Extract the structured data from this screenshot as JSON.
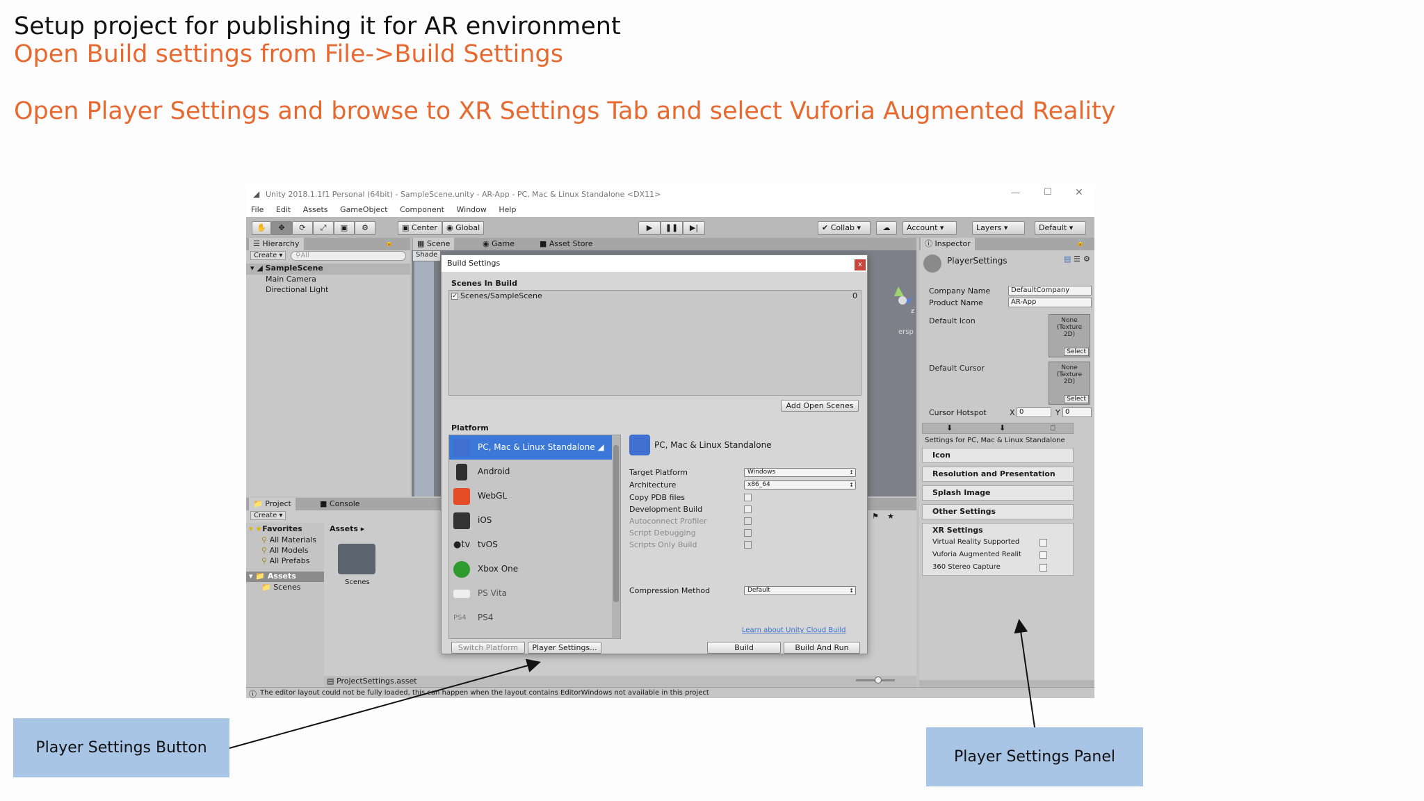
{
  "slide": {
    "line1": "Setup project for publishing it for AR environment",
    "line2": "Open Build settings from File->Build Settings",
    "line3": "Open Player Settings and browse to XR Settings Tab and select Vuforia Augmented Reality",
    "accent_color": "#e8692f"
  },
  "window": {
    "title": "Unity 2018.1.1f1 Personal (64bit) - SampleScene.unity - AR-App - PC, Mac & Linux Standalone <DX11>",
    "menu": [
      "File",
      "Edit",
      "Assets",
      "GameObject",
      "Component",
      "Window",
      "Help"
    ]
  },
  "toolbar": {
    "center": "Center",
    "global": "Global",
    "collab": "Collab",
    "account": "Account",
    "layers": "Layers",
    "layout": "Default"
  },
  "hierarchy": {
    "tab": "Hierarchy",
    "create": "Create",
    "search_placeholder": "All",
    "scene": "SampleScene",
    "items": [
      "Main Camera",
      "Directional Light"
    ]
  },
  "scene_tabs": {
    "scene": "Scene",
    "game": "Game",
    "asset_store": "Asset Store",
    "shaded": "Shade",
    "persp": "ersp"
  },
  "project": {
    "tab": "Project",
    "console_tab": "Console",
    "create": "Create",
    "favorites": "Favorites",
    "favorite_items": [
      "All Materials",
      "All Models",
      "All Prefabs"
    ],
    "assets": "Assets",
    "asset_children": [
      "Scenes"
    ],
    "breadcrumb": "Assets",
    "folder": "Scenes",
    "selected_file": "ProjectSettings.asset"
  },
  "status_bar": "The editor layout could not be fully loaded, this can happen when the layout contains EditorWindows not available in this project",
  "build_settings": {
    "title": "Build Settings",
    "close": "x",
    "scenes_header": "Scenes In Build",
    "scenes": [
      {
        "name": "Scenes/SampleScene",
        "index": "0",
        "checked": true
      }
    ],
    "add_open_scenes": "Add Open Scenes",
    "platform_header": "Platform",
    "platforms": [
      {
        "name": "PC, Mac & Linux Standalone",
        "selected": true,
        "icon": "pc-mac-linux-icon",
        "color": "#3f6fcf"
      },
      {
        "name": "Android",
        "icon": "android-phone-icon",
        "color": "#2e2e2e"
      },
      {
        "name": "WebGL",
        "icon": "html5-icon",
        "color": "#e44d26"
      },
      {
        "name": "iOS",
        "icon": "ios-device-icon",
        "color": "#333333"
      },
      {
        "name": "tvOS",
        "icon": "apple-tv-icon",
        "color": "#222222"
      },
      {
        "name": "Xbox One",
        "icon": "xbox-icon",
        "color": "#2e9b2e"
      },
      {
        "name": "PS Vita",
        "icon": "ps-vita-icon",
        "color": "#eeeeee"
      },
      {
        "name": "PS4",
        "icon": "ps4-icon",
        "color": "#777777"
      }
    ],
    "selected_platform": "PC, Mac & Linux Standalone",
    "options": {
      "target_platform": {
        "label": "Target Platform",
        "value": "Windows"
      },
      "architecture": {
        "label": "Architecture",
        "value": "x86_64"
      },
      "checkboxes": [
        "Copy PDB files",
        "Development Build",
        "Autoconnect Profiler",
        "Script Debugging",
        "Scripts Only Build"
      ],
      "compression": {
        "label": "Compression Method",
        "value": "Default"
      }
    },
    "cloud_link": "Learn about Unity Cloud Build",
    "switch_platform": "Switch Platform",
    "player_settings": "Player Settings...",
    "build": "Build",
    "build_and_run": "Build And Run"
  },
  "inspector": {
    "tab": "Inspector",
    "title": "PlayerSettings",
    "company_label": "Company Name",
    "company_value": "DefaultCompany",
    "product_label": "Product Name",
    "product_value": "AR-App",
    "default_icon": "Default Icon",
    "default_cursor": "Default Cursor",
    "texture_none": "None\n(Texture\n2D)",
    "select": "Select",
    "cursor_hotspot": "Cursor Hotspot",
    "hotspot_x_label": "X",
    "hotspot_x": "0",
    "hotspot_y_label": "Y",
    "hotspot_y": "0",
    "settings_for": "Settings for PC, Mac & Linux Standalone",
    "sections": [
      "Icon",
      "Resolution and Presentation",
      "Splash Image",
      "Other Settings"
    ],
    "xr": {
      "title": "XR Settings",
      "options": [
        "Virtual Reality Supported",
        "Vuforia Augmented Realit",
        "360 Stereo Capture"
      ]
    }
  },
  "callouts": {
    "player_settings_button": "Player Settings Button",
    "player_settings_panel": "Player Settings Panel",
    "color": "#a9c5e6"
  }
}
